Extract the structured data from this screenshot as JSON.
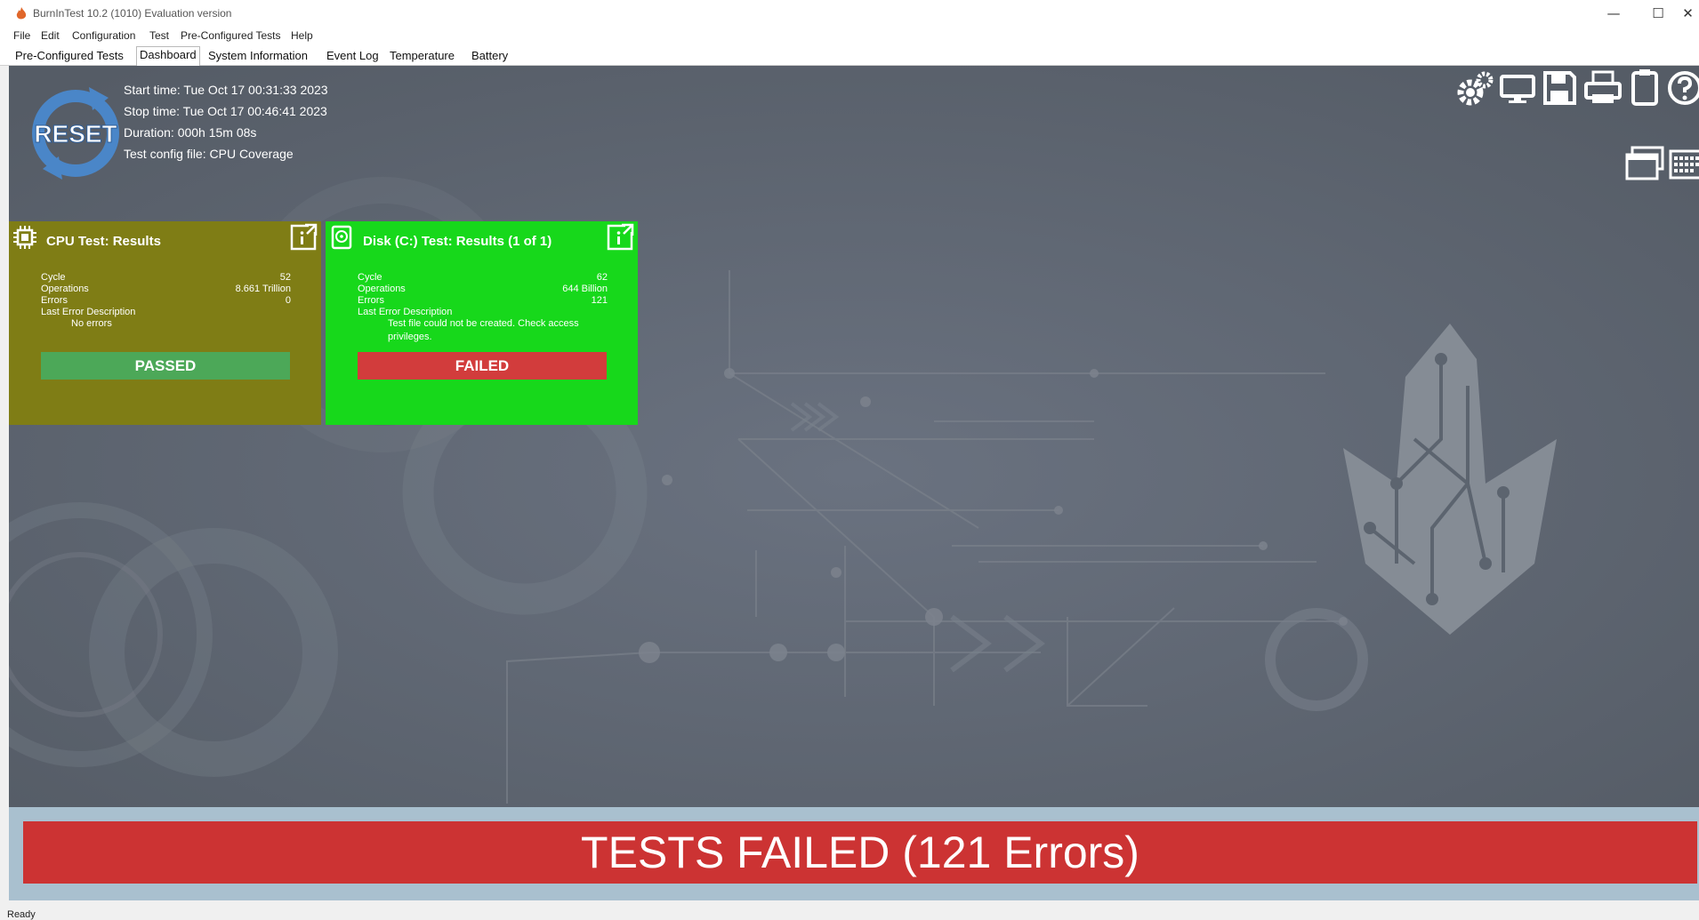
{
  "window": {
    "title": "BurnInTest 10.2 (1010) Evaluation version",
    "controls": {
      "minimize": "—",
      "maximize": "☐",
      "close": "✕"
    }
  },
  "menu": [
    "File",
    "Edit",
    "Configuration",
    "Test",
    "Pre-Configured Tests",
    "Help"
  ],
  "tabs": [
    {
      "label": "Pre-Configured Tests",
      "active": false
    },
    {
      "label": "Dashboard",
      "active": true
    },
    {
      "label": "System Information",
      "active": false
    },
    {
      "label": "Event Log",
      "active": false
    },
    {
      "label": "Temperature",
      "active": false
    },
    {
      "label": "Battery",
      "active": false
    }
  ],
  "dashboard": {
    "reset_label": "RESET",
    "start_time": "Start time: Tue Oct 17 00:31:33 2023",
    "stop_time": "Stop time: Tue Oct 17 00:46:41 2023",
    "duration": "Duration: 000h 15m 08s",
    "config_file": "Test config file: CPU Coverage",
    "toolbar_icons": [
      "settings-icon",
      "monitor-icon",
      "save-icon",
      "print-icon",
      "clipboard-icon",
      "help-icon",
      "window-icon",
      "keyboard-icon"
    ]
  },
  "cards": {
    "cpu": {
      "title": "CPU Test: Results",
      "cycle_label": "Cycle",
      "cycle": "52",
      "operations_label": "Operations",
      "operations": "8.661 Trillion",
      "errors_label": "Errors",
      "errors": "0",
      "last_error_label": "Last Error Description",
      "last_error": "No errors",
      "status": "PASSED"
    },
    "disk": {
      "title": "Disk (C:) Test: Results (1 of 1)",
      "cycle_label": "Cycle",
      "cycle": "62",
      "operations_label": "Operations",
      "operations": "644 Billion",
      "errors_label": "Errors",
      "errors": "121",
      "last_error_label": "Last Error Description",
      "last_error": "Test file could not be created. Check access privileges.",
      "status": "FAILED"
    }
  },
  "result_banner": "TESTS FAILED (121 Errors)",
  "status_bar": "Ready",
  "colors": {
    "dashboard_bg": "#5c646f",
    "cpu_card": "#7f7d15",
    "disk_card": "#17d81b",
    "passed": "#4ca858",
    "failed": "#d23c3c",
    "banner": "#cc3333",
    "reset_logo": "#4a86c8"
  }
}
